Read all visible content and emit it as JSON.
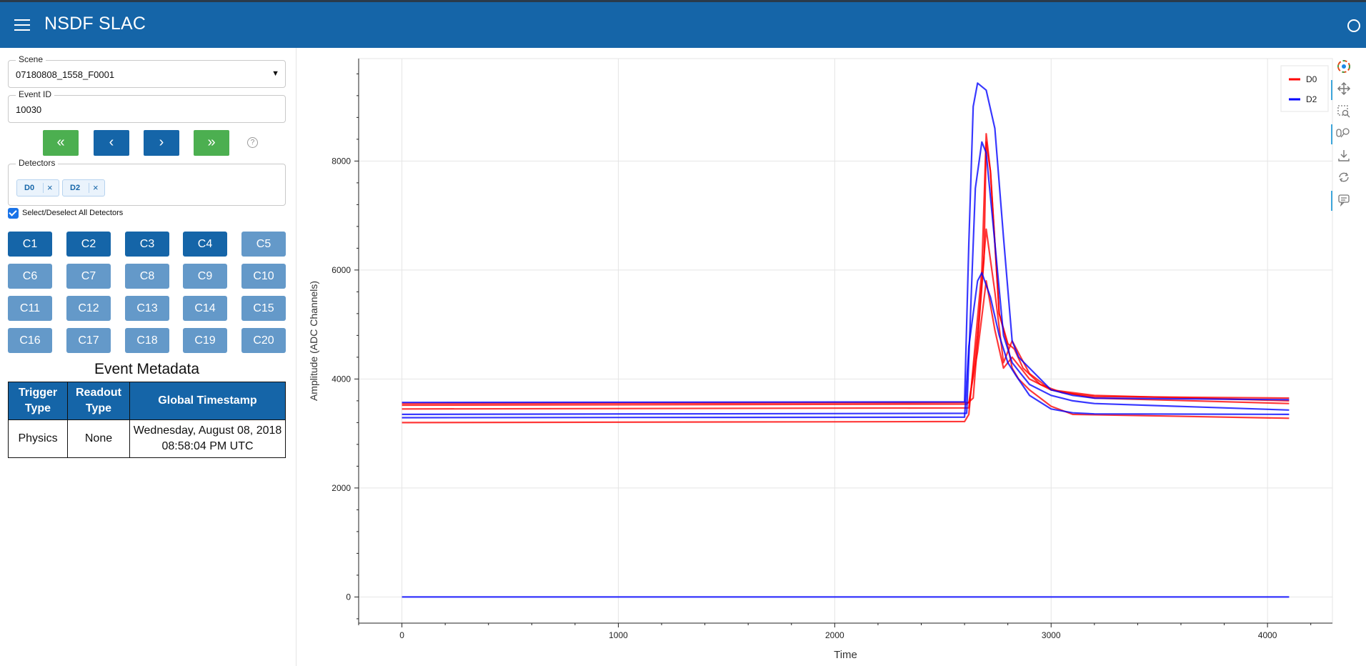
{
  "app": {
    "title": "NSDF SLAC"
  },
  "sidebar": {
    "scene": {
      "label": "Scene",
      "value": "07180808_1558_F0001"
    },
    "event_id": {
      "label": "Event ID",
      "value": "10030"
    },
    "nav_buttons": {
      "first": "«",
      "prev": "‹",
      "next": "›",
      "last": "»"
    },
    "help_glyph": "?",
    "detectors": {
      "label": "Detectors",
      "chips": [
        {
          "label": "D0",
          "remove": "×"
        },
        {
          "label": "D2",
          "remove": "×"
        }
      ]
    },
    "select_all": {
      "label": "Select/Deselect All Detectors",
      "checked": true
    },
    "channels": [
      {
        "label": "C1",
        "active": true
      },
      {
        "label": "C2",
        "active": true
      },
      {
        "label": "C3",
        "active": true
      },
      {
        "label": "C4",
        "active": true
      },
      {
        "label": "C5",
        "active": false
      },
      {
        "label": "C6",
        "active": false
      },
      {
        "label": "C7",
        "active": false
      },
      {
        "label": "C8",
        "active": false
      },
      {
        "label": "C9",
        "active": false
      },
      {
        "label": "C10",
        "active": false
      },
      {
        "label": "C11",
        "active": false
      },
      {
        "label": "C12",
        "active": false
      },
      {
        "label": "C13",
        "active": false
      },
      {
        "label": "C14",
        "active": false
      },
      {
        "label": "C15",
        "active": false
      },
      {
        "label": "C16",
        "active": false
      },
      {
        "label": "C17",
        "active": false
      },
      {
        "label": "C18",
        "active": false
      },
      {
        "label": "C19",
        "active": false
      },
      {
        "label": "C20",
        "active": false
      }
    ],
    "metadata": {
      "title": "Event Metadata",
      "headers": [
        "Trigger Type",
        "Readout Type",
        "Global Timestamp"
      ],
      "row": {
        "trigger": "Physics",
        "readout": "None",
        "timestamp_line1": "Wednesday, August 08, 2018",
        "timestamp_line2": "08:58:04 PM UTC"
      }
    }
  },
  "colors": {
    "accent": "#1565a8",
    "nav_green": "#4caf50",
    "channel_on": "#1565a8",
    "channel_off": "#6499c9",
    "d0": "#ff0000",
    "d2": "#0000ff"
  },
  "toolbar": [
    "bokeh-logo-icon",
    "pan-icon",
    "box-zoom-icon",
    "wheel-zoom-icon",
    "save-icon",
    "reset-icon",
    "hover-icon"
  ],
  "chart_data": {
    "type": "line",
    "xlabel": "Time",
    "ylabel": "Amplitude (ADC Channels)",
    "xlim": [
      -200,
      4300
    ],
    "ylim": [
      -480,
      9880
    ],
    "xticks": [
      0,
      1000,
      2000,
      3000,
      4000
    ],
    "yticks": [
      0,
      2000,
      4000,
      6000,
      8000
    ],
    "grid": true,
    "legend": {
      "position": "top-right",
      "entries": [
        {
          "name": "D0",
          "color": "#ff0000"
        },
        {
          "name": "D2",
          "color": "#0000ff"
        }
      ]
    },
    "series": [
      {
        "name": "D0",
        "color": "#ff0000",
        "x": [
          0,
          2600,
          2620,
          2680,
          2700,
          2720,
          2760,
          2800,
          2820,
          2850,
          2900,
          3000,
          3100,
          4100
        ],
        "y": [
          3200,
          3220,
          3350,
          6000,
          8500,
          7800,
          5200,
          4600,
          4200,
          4000,
          3800,
          3500,
          3350,
          3280
        ]
      },
      {
        "name": "D0",
        "color": "#ff0000",
        "x": [
          0,
          2610,
          2640,
          2690,
          2700,
          2720,
          2760,
          2800,
          2830,
          2870,
          2950,
          3050,
          3200,
          4100
        ],
        "y": [
          3520,
          3540,
          3650,
          6200,
          8350,
          7800,
          5200,
          4650,
          4550,
          4200,
          3900,
          3750,
          3680,
          3650
        ]
      },
      {
        "name": "D0",
        "color": "#ff0000",
        "x": [
          0,
          2620,
          2660,
          2700,
          2740,
          2780,
          2820,
          2860,
          2900,
          3000,
          3200,
          4100
        ],
        "y": [
          3450,
          3470,
          4800,
          6750,
          5600,
          4300,
          4700,
          4400,
          4100,
          3800,
          3650,
          3550
        ]
      },
      {
        "name": "D0",
        "color": "#ff0000",
        "x": [
          0,
          2620,
          2660,
          2700,
          2740,
          2780,
          2820,
          2860,
          2900,
          3000,
          3200,
          4100
        ],
        "y": [
          3550,
          3570,
          4500,
          5800,
          4900,
          4200,
          4400,
          4200,
          4000,
          3800,
          3700,
          3600
        ]
      },
      {
        "name": "D2",
        "color": "#0000ff",
        "x": [
          0,
          2600,
          2620,
          2640,
          2660,
          2700,
          2740,
          2780,
          2820,
          2850,
          2900,
          3000,
          3100,
          3200,
          4100
        ],
        "y": [
          3570,
          3580,
          6500,
          9000,
          9430,
          9300,
          8600,
          6600,
          4700,
          4400,
          4200,
          3800,
          3700,
          3650,
          3620
        ]
      },
      {
        "name": "D2",
        "color": "#0000ff",
        "x": [
          0,
          2610,
          2650,
          2680,
          2700,
          2740,
          2780,
          2820,
          2860,
          2900,
          3000,
          3100,
          3200,
          4100
        ],
        "y": [
          3350,
          3370,
          7500,
          8350,
          8150,
          6500,
          4800,
          4300,
          4100,
          3900,
          3700,
          3600,
          3550,
          3430
        ]
      },
      {
        "name": "D2",
        "color": "#0000ff",
        "x": [
          0,
          2600,
          2620,
          2660,
          2680,
          2720,
          2760,
          2800,
          2840,
          2900,
          3000,
          3100,
          3200,
          4100
        ],
        "y": [
          3290,
          3300,
          4600,
          5800,
          5950,
          5500,
          4800,
          4300,
          4050,
          3700,
          3450,
          3380,
          3360,
          3350
        ]
      },
      {
        "name": "D2",
        "color": "#0000ff",
        "x": [
          0,
          4100
        ],
        "y": [
          0,
          0
        ]
      }
    ]
  }
}
